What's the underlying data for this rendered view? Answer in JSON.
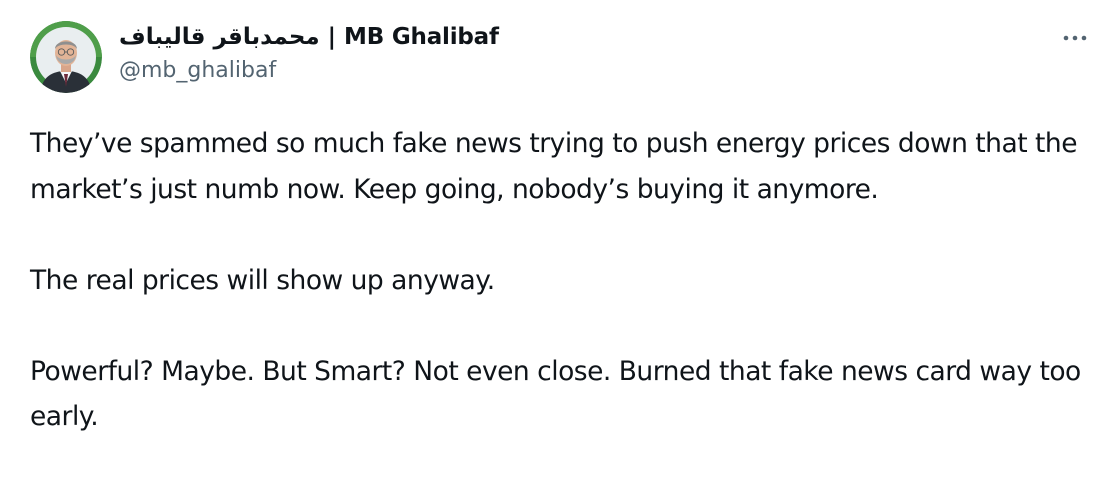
{
  "tweet": {
    "author": {
      "display_name": "محمدباقر قالیباف | MB Ghalibaf",
      "handle": "@mb_ghalibaf",
      "avatar_icon": "profile-photo"
    },
    "more_icon": "more-dots-icon",
    "paragraphs": [
      "They’ve spammed so much fake news trying to push energy prices down that the market’s just numb now. Keep going, nobody’s buying it anymore.",
      "The real prices will show up anyway.",
      "Powerful? Maybe. But Smart? Not even close. Burned that fake news card way too early."
    ]
  },
  "colors": {
    "text_primary": "#0f1419",
    "text_secondary": "#536471",
    "background": "#ffffff",
    "avatar_ring": "#3a8a3e"
  }
}
